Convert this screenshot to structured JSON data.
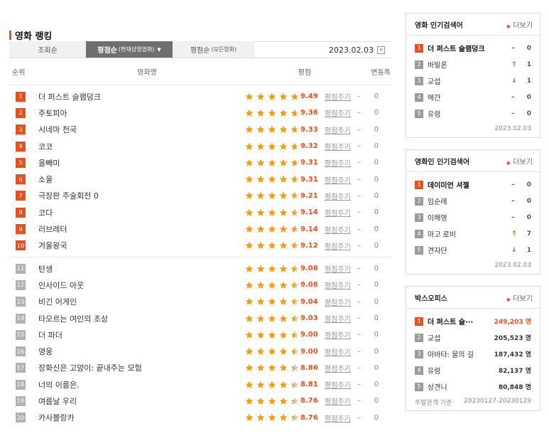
{
  "ranking": {
    "title": "영화 랭킹",
    "tabs": [
      {
        "label": "조회순",
        "sub": ""
      },
      {
        "label": "평점순",
        "sub": "(현재상영영화)"
      },
      {
        "label": "평점순",
        "sub": "(모든영화)"
      }
    ],
    "active_tab_index": 1,
    "date": "2023.02.03",
    "prev_glyph": "<",
    "headers": {
      "rank": "순위",
      "title": "영화명",
      "rating": "평점",
      "change": "변동폭"
    },
    "rate_label": "평점주기",
    "movies": [
      {
        "rank": "1",
        "title": "더 퍼스트 슬램덩크",
        "score": "9.49",
        "change_sign": "–",
        "change": "0"
      },
      {
        "rank": "2",
        "title": "주토피아",
        "score": "9.36",
        "change_sign": "–",
        "change": "0"
      },
      {
        "rank": "3",
        "title": "시네마 천국",
        "score": "9.33",
        "change_sign": "–",
        "change": "0"
      },
      {
        "rank": "4",
        "title": "코코",
        "score": "9.32",
        "change_sign": "–",
        "change": "0"
      },
      {
        "rank": "5",
        "title": "올빼미",
        "score": "9.31",
        "change_sign": "–",
        "change": "0"
      },
      {
        "rank": "6",
        "title": "소울",
        "score": "9.31",
        "change_sign": "–",
        "change": "0"
      },
      {
        "rank": "7",
        "title": "극장판 주술회전 0",
        "score": "9.21",
        "change_sign": "–",
        "change": "0"
      },
      {
        "rank": "8",
        "title": "코다",
        "score": "9.14",
        "change_sign": "–",
        "change": "0"
      },
      {
        "rank": "9",
        "title": "러브레터",
        "score": "9.14",
        "change_sign": "–",
        "change": "0"
      },
      {
        "rank": "10",
        "title": "겨울왕국",
        "score": "9.12",
        "change_sign": "–",
        "change": "0"
      },
      {
        "rank": "11",
        "title": "탄생",
        "score": "9.08",
        "change_sign": "–",
        "change": "0"
      },
      {
        "rank": "12",
        "title": "인사이드 아웃",
        "score": "9.08",
        "change_sign": "–",
        "change": "0"
      },
      {
        "rank": "13",
        "title": "비긴 어게인",
        "score": "9.04",
        "change_sign": "–",
        "change": "0"
      },
      {
        "rank": "14",
        "title": "타오르는 여인의 초상",
        "score": "9.03",
        "change_sign": "–",
        "change": "0"
      },
      {
        "rank": "15",
        "title": "더 파더",
        "score": "9.00",
        "change_sign": "–",
        "change": "0"
      },
      {
        "rank": "16",
        "title": "영웅",
        "score": "9.00",
        "change_sign": "–",
        "change": "0"
      },
      {
        "rank": "17",
        "title": "장화신은 고양이: 끝내주는 모험",
        "score": "8.86",
        "change_sign": "–",
        "change": "0"
      },
      {
        "rank": "18",
        "title": "너의 이름은.",
        "score": "8.81",
        "change_sign": "–",
        "change": "0"
      },
      {
        "rank": "19",
        "title": "여름날 우리",
        "score": "8.76",
        "change_sign": "–",
        "change": "0"
      },
      {
        "rank": "20",
        "title": "카사블랑카",
        "score": "8.76",
        "change_sign": "–",
        "change": "0"
      }
    ]
  },
  "more_label": "더보기",
  "movie_search": {
    "title": "영화 인기검색어",
    "items": [
      {
        "rank": "1",
        "name": "더 퍼스트 슬램덩크",
        "dir": "none",
        "symbol": "–",
        "value": "0"
      },
      {
        "rank": "2",
        "name": "바빌론",
        "dir": "up",
        "symbol": "↑",
        "value": "1"
      },
      {
        "rank": "3",
        "name": "교섭",
        "dir": "down",
        "symbol": "↓",
        "value": "1"
      },
      {
        "rank": "4",
        "name": "메간",
        "dir": "none",
        "symbol": "–",
        "value": "0"
      },
      {
        "rank": "5",
        "name": "유령",
        "dir": "none",
        "symbol": "–",
        "value": "0"
      }
    ],
    "date": "2023.02.03"
  },
  "people_search": {
    "title": "영화인 인기검색어",
    "items": [
      {
        "rank": "1",
        "name": "데이미언 셔젤",
        "dir": "none",
        "symbol": "–",
        "value": "0"
      },
      {
        "rank": "2",
        "name": "임순례",
        "dir": "none",
        "symbol": "–",
        "value": "0"
      },
      {
        "rank": "3",
        "name": "이해영",
        "dir": "none",
        "symbol": "–",
        "value": "0"
      },
      {
        "rank": "4",
        "name": "마고 로비",
        "dir": "up",
        "symbol": "↑",
        "value": "7"
      },
      {
        "rank": "5",
        "name": "견자단",
        "dir": "down",
        "symbol": "↓",
        "value": "1"
      }
    ],
    "date": "2023.02.03"
  },
  "box_office": {
    "title": "박스오피스",
    "items": [
      {
        "rank": "1",
        "name": "더 퍼스트 슬···",
        "audience": "249,203 명"
      },
      {
        "rank": "2",
        "name": "교섭",
        "audience": "205,523 명"
      },
      {
        "rank": "3",
        "name": "아바타: 물의 길",
        "audience": "187,432 명"
      },
      {
        "rank": "4",
        "name": "유령",
        "audience": "82,137 명"
      },
      {
        "rank": "5",
        "name": "상견니",
        "audience": "80,848 명"
      }
    ],
    "footer_label": "주말관객 기준",
    "footer_range": "20230127-20230129"
  },
  "colors": {
    "accent": "#e8501e",
    "star": "#f39c12",
    "star_empty": "#c8c8c8",
    "down": "#3a65c8"
  },
  "icons": {
    "star": "star-icon",
    "caret": "caret-down-icon",
    "arrow": "chevron-right-icon"
  }
}
